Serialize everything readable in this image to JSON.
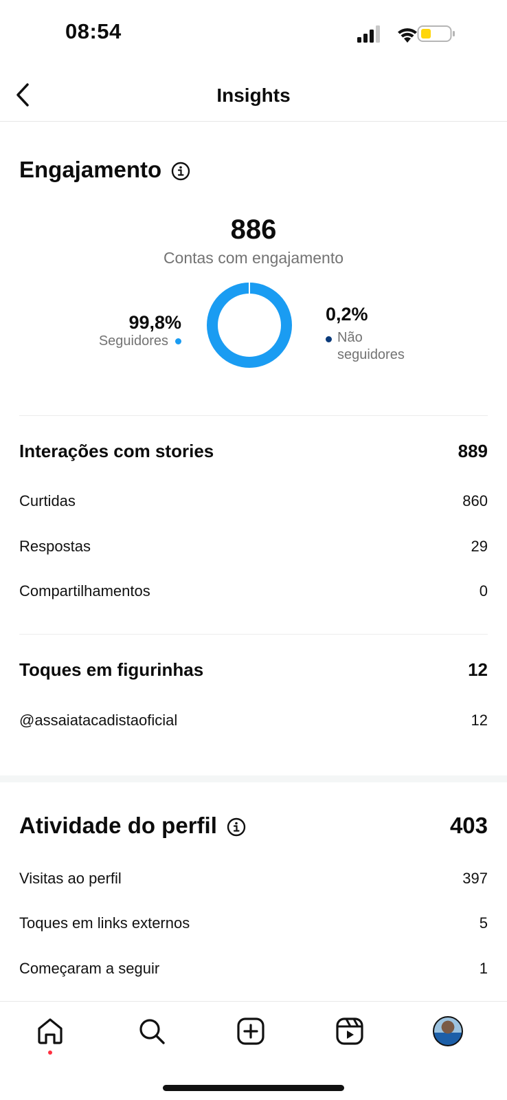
{
  "status_bar": {
    "time": "08:54"
  },
  "header": {
    "title": "Insights"
  },
  "engagement": {
    "title": "Engajamento",
    "total": "886",
    "total_label": "Contas com engajamento",
    "followers": {
      "percent": "99,8%",
      "label": "Seguidores",
      "color": "#1a9cf2"
    },
    "non_followers": {
      "percent": "0,2%",
      "label": "Não seguidores",
      "label_line1": "Não",
      "label_line2": "seguidores",
      "color": "#0a3a7a"
    }
  },
  "chart_data": {
    "type": "pie",
    "categories": [
      "Seguidores",
      "Não seguidores"
    ],
    "values": [
      99.8,
      0.2
    ],
    "colors": [
      "#1a9cf2",
      "#0a3a7a"
    ],
    "donut": true
  },
  "story_interactions": {
    "title": "Interações com stories",
    "total": "889",
    "rows": [
      {
        "label": "Curtidas",
        "value": "860"
      },
      {
        "label": "Respostas",
        "value": "29"
      },
      {
        "label": "Compartilhamentos",
        "value": "0"
      }
    ]
  },
  "sticker_taps": {
    "title": "Toques em figurinhas",
    "total": "12",
    "rows": [
      {
        "label": "@assaiatacadistaoficial",
        "value": "12"
      }
    ]
  },
  "profile_activity": {
    "title": "Atividade do perfil",
    "total": "403",
    "rows": [
      {
        "label": "Visitas ao perfil",
        "value": "397"
      },
      {
        "label": "Toques em links externos",
        "value": "5"
      },
      {
        "label": "Começaram a seguir",
        "value": "1"
      }
    ]
  },
  "nav": {
    "items": [
      "home-icon",
      "search-icon",
      "create-icon",
      "reels-icon",
      "profile-avatar"
    ]
  }
}
